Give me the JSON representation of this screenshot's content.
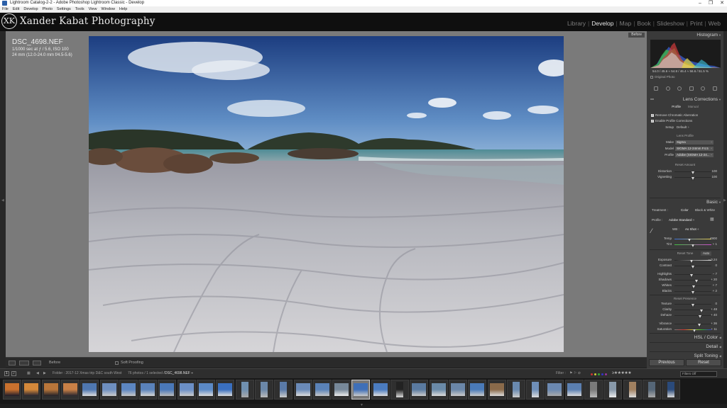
{
  "window": {
    "title": "Lightroom Catalog-2-2 - Adobe Photoshop Lightroom Classic - Develop",
    "controls": [
      "–",
      "❐",
      "✕"
    ]
  },
  "menu": [
    "File",
    "Edit",
    "Develop",
    "Photo",
    "Settings",
    "Tools",
    "View",
    "Window",
    "Help"
  ],
  "identity": {
    "name": "Xander Kabat Photography",
    "mark": "XK"
  },
  "modules": [
    "Library",
    "Develop",
    "Map",
    "Book",
    "Slideshow",
    "Print",
    "Web"
  ],
  "active_module": "Develop",
  "view": {
    "before_label": "Before",
    "file_name": "DSC_4698.NEF",
    "exposure_info": "1/1000 sec at ƒ / 5.6, ISO 100",
    "lens_info": "24 mm (12.0-24.0 mm f/4.5-5.6)"
  },
  "toolbar": {
    "before_label": "Before",
    "soft_proofing": "Soft Proofing"
  },
  "histogram": {
    "title": "Histogram",
    "readout": "54.0 / 45.6   ≈   54.8 / 46.4   ≈   56.6 / 51.5 %",
    "original_photo": "Original Photo"
  },
  "lens_corrections": {
    "title": "Lens Corrections",
    "tabs": [
      "Profile",
      "Manual"
    ],
    "active_tab": "Profile",
    "remove_ca": "Remove Chromatic Aberration",
    "enable_profile": "Enable Profile Corrections",
    "setup_label": "Setup",
    "setup_value": "Default ÷",
    "lens_profile_label": "Lens Profile",
    "make_label": "Make",
    "make_value": "Sigma",
    "model_label": "Model",
    "model_value": "SIGMA 12-24mm F4.5",
    "profile_label": "Profile",
    "profile_value": "Adobe (SIGMA 12-24...",
    "amount_label": "Reset Amount",
    "distortion_label": "Distortion",
    "distortion_value": "100",
    "distortion_level": 0.5,
    "vignetting_label": "Vignetting",
    "vignetting_value": "100",
    "vignetting_level": 0.5
  },
  "basic": {
    "title": "Basic",
    "treatment_label": "Treatment :",
    "treatment_color": "Color",
    "treatment_bw": "Black & White",
    "profile_label": "Profile :",
    "profile_value": "Adobe Standard ÷",
    "wb_label": "WB :",
    "wb_value": "As Shot ÷",
    "temp_label": "Temp",
    "temp_value": "4900",
    "temp_level": 0.42,
    "tint_label": "Tint",
    "tint_value": "+ 1",
    "tint_level": 0.5,
    "tone_label": "Reset Tone",
    "auto_label": "Auto",
    "sliders": [
      {
        "label": "Exposure",
        "value": "− 0.24",
        "level": 0.48
      },
      {
        "label": "Contrast",
        "value": "0",
        "level": 0.5
      },
      {
        "label": "Highlights",
        "value": "− 7",
        "level": 0.47
      },
      {
        "label": "Shadows",
        "value": "+ 20",
        "level": 0.6
      },
      {
        "label": "Whites",
        "value": "+ 7",
        "level": 0.53
      },
      {
        "label": "Blacks",
        "value": "+ 2",
        "level": 0.51
      }
    ],
    "presence_label": "Reset Presence",
    "presence": [
      {
        "label": "Texture",
        "value": "0",
        "level": 0.5
      },
      {
        "label": "Clarity",
        "value": "+ 48",
        "level": 0.74
      },
      {
        "label": "Dehaze",
        "value": "+ 40",
        "level": 0.7
      },
      {
        "label": "Vibrance",
        "value": "+ 36",
        "level": 0.68
      },
      {
        "label": "Saturation",
        "value": "+ 11",
        "level": 0.55
      }
    ]
  },
  "collapsed_panels": [
    "HSL / Color",
    "Detail",
    "Split Toning"
  ],
  "buttons": {
    "previous": "Previous",
    "reset": "Reset"
  },
  "filmbar": {
    "primary": "1",
    "secondary": "2",
    "folder": "Folder : 2017-12 Xmas trip D&C south West",
    "count": "76 photos / 1 selected /",
    "selected_file": "DSC_4698.NEF ÷",
    "filter_label": "Filter :",
    "filter_value": "Filters Off"
  },
  "colors": {
    "accent": "#e6e6e6",
    "panel_bg": "#3a3a3a",
    "canvas_bg": "#7a7a7a",
    "sky_top": "#1c3d80",
    "sky_bottom": "#8fb3d8",
    "sand": "#c9c9ce"
  }
}
